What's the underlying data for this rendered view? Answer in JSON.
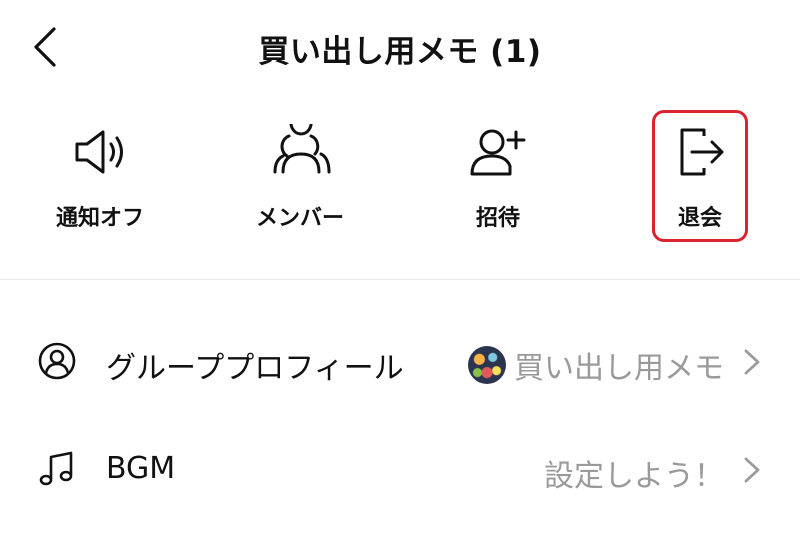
{
  "header": {
    "title": "買い出し用メモ (1)"
  },
  "actions": [
    {
      "label": "通知オフ",
      "icon": "speaker-icon"
    },
    {
      "label": "メンバー",
      "icon": "members-icon"
    },
    {
      "label": "招待",
      "icon": "add-person-icon"
    },
    {
      "label": "退会",
      "icon": "leave-icon"
    }
  ],
  "highlight_color": "#d9232e",
  "settings": {
    "profile": {
      "label": "グループプロフィール",
      "value": "買い出し用メモ",
      "icon": "profile-circle-icon"
    },
    "bgm": {
      "label": "BGM",
      "value": "設定しよう！",
      "icon": "music-note-icon"
    }
  }
}
